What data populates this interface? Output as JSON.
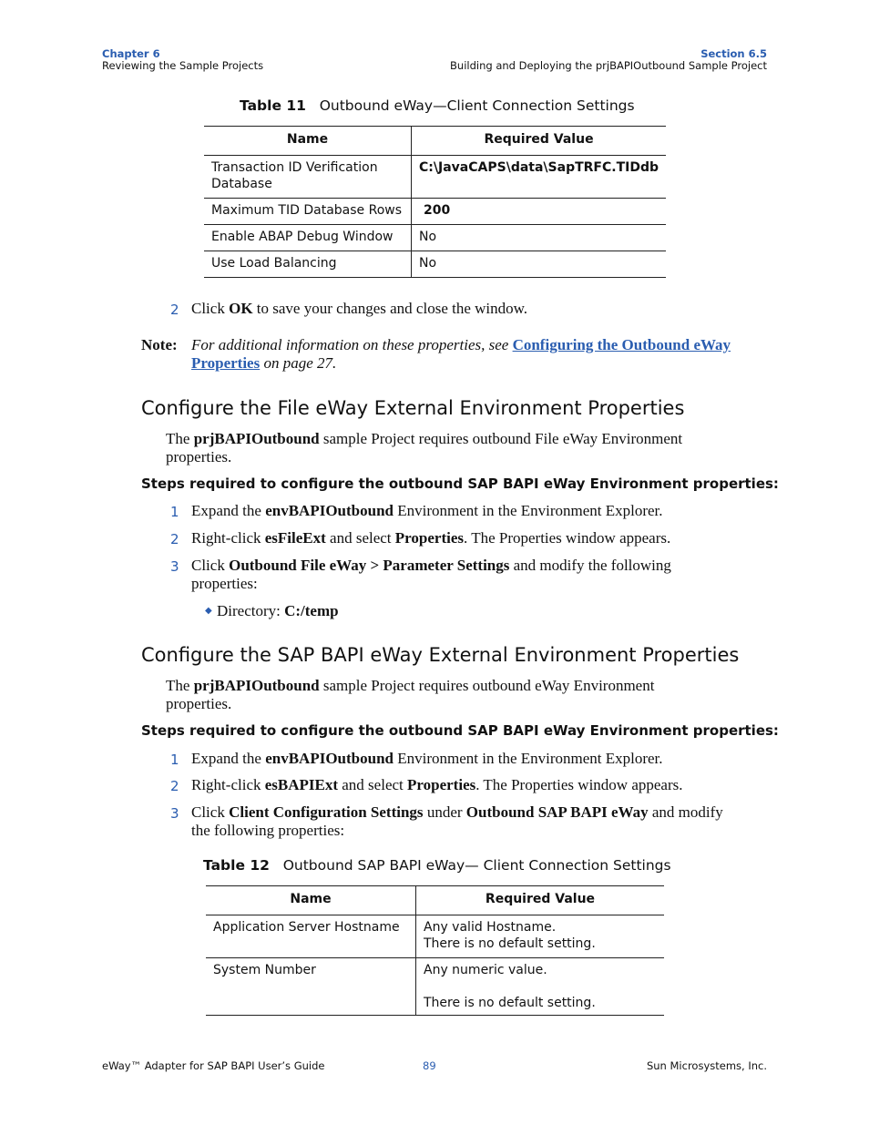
{
  "header": {
    "left_chapter": "Chapter 6",
    "left_title": "Reviewing the Sample Projects",
    "right_section": "Section 6.5",
    "right_title": "Building and Deploying the prjBAPIOutbound Sample Project"
  },
  "table11": {
    "caption_label": "Table 11",
    "caption_text": "Outbound eWay—Client Connection Settings",
    "columns": [
      "Name",
      "Required Value"
    ],
    "rows": [
      {
        "name": "Transaction ID Verification Database",
        "value": "C:\\JavaCAPS\\data\\SapTRFC.TIDdb",
        "bold": true
      },
      {
        "name": "Maximum TID Database Rows",
        "value": "200",
        "bold": true
      },
      {
        "name": "Enable ABAP Debug Window",
        "value": "No",
        "bold": false
      },
      {
        "name": "Use Load Balancing",
        "value": "No",
        "bold": false
      }
    ]
  },
  "step_after_table11": {
    "number": "2",
    "pre": "Click ",
    "bold": "OK",
    "post": " to save your changes and close the window."
  },
  "note": {
    "label": "Note:",
    "text_pre": "For additional information on these properties, see ",
    "link": "Configuring the Outbound eWay Properties",
    "text_post": " on page 27."
  },
  "section_file": {
    "heading": "Configure the File eWay External Environment Properties",
    "intro_pre": "The ",
    "intro_bold": "prjBAPIOutbound",
    "intro_post": " sample Project requires outbound File eWay Environment properties.",
    "steps_title": "Steps required to configure the outbound SAP BAPI eWay Environment properties:",
    "steps": [
      {
        "number": "1",
        "parts": [
          {
            "t": "Expand the "
          },
          {
            "b": "envBAPIOutbound"
          },
          {
            "t": " Environment in the Environment Explorer."
          }
        ]
      },
      {
        "number": "2",
        "parts": [
          {
            "t": "Right-click "
          },
          {
            "b": "esFileExt"
          },
          {
            "t": " and select "
          },
          {
            "b": "Properties"
          },
          {
            "t": ". The Properties window appears."
          }
        ]
      },
      {
        "number": "3",
        "parts": [
          {
            "t": "Click "
          },
          {
            "b": "Outbound File eWay > Parameter Settings"
          },
          {
            "t": " and modify the following properties:"
          }
        ]
      }
    ],
    "bullet": {
      "label": "Directory: ",
      "value": "C:/temp"
    }
  },
  "section_sap": {
    "heading": "Configure the SAP BAPI eWay External Environment Properties",
    "intro_pre": "The ",
    "intro_bold": "prjBAPIOutbound",
    "intro_post": " sample Project requires outbound eWay Environment properties.",
    "steps_title": "Steps required to configure the outbound SAP BAPI eWay Environment properties:",
    "steps": [
      {
        "number": "1",
        "parts": [
          {
            "t": "Expand the "
          },
          {
            "b": "envBAPIOutbound"
          },
          {
            "t": " Environment in the Environment Explorer."
          }
        ]
      },
      {
        "number": "2",
        "parts": [
          {
            "t": "Right-click "
          },
          {
            "b": "esBAPIExt"
          },
          {
            "t": " and select "
          },
          {
            "b": "Properties"
          },
          {
            "t": ". The Properties window appears."
          }
        ]
      },
      {
        "number": "3",
        "parts": [
          {
            "t": "Click "
          },
          {
            "b": "Client Configuration Settings"
          },
          {
            "t": " under "
          },
          {
            "b": "Outbound SAP BAPI eWay"
          },
          {
            "t": " and modify the following properties:"
          }
        ]
      }
    ]
  },
  "table12": {
    "caption_label": "Table 12",
    "caption_text": "Outbound SAP BAPI eWay— Client Connection Settings",
    "columns": [
      "Name",
      "Required Value"
    ],
    "rows": [
      {
        "name": "Application Server Hostname",
        "value_lines": [
          "Any valid Hostname.",
          "There is no default setting."
        ]
      },
      {
        "name": "System Number",
        "value_lines": [
          "Any numeric value.",
          "",
          "There is no default setting."
        ]
      }
    ]
  },
  "footer": {
    "left": "eWay™ Adapter for SAP BAPI User’s Guide",
    "page": "89",
    "right": "Sun Microsystems, Inc."
  }
}
